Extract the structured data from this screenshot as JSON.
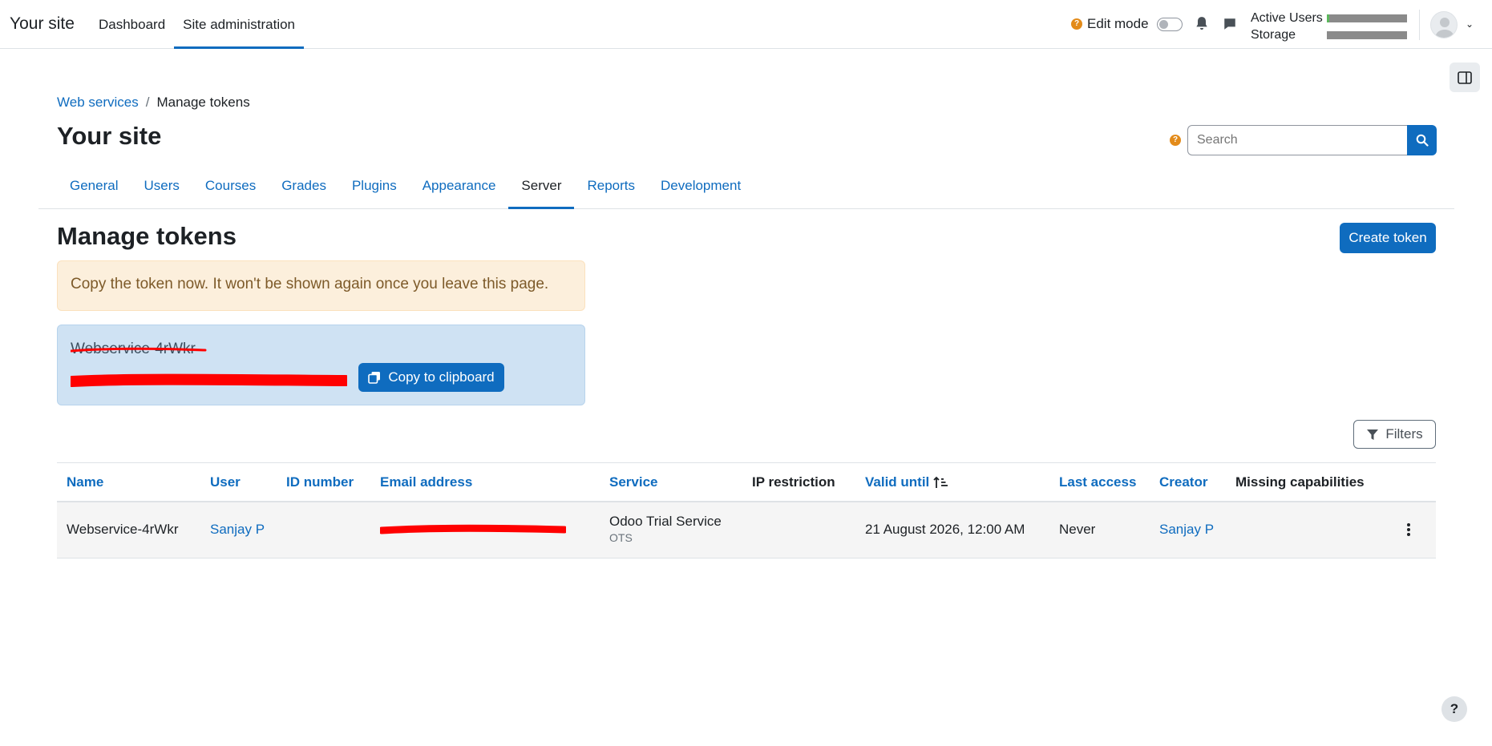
{
  "navbar": {
    "brand": "Your site",
    "primary_nav": [
      "Dashboard",
      "Site administration"
    ],
    "edit_mode_label": "Edit mode",
    "meters": {
      "active_users_label": "Active Users",
      "active_users_fraction": 0.03,
      "storage_label": "Storage",
      "storage_fraction": 0.0
    }
  },
  "breadcrumb": {
    "parent": "Web services",
    "separator": "/",
    "current": "Manage tokens"
  },
  "page": {
    "site_title": "Your site",
    "heading": "Manage tokens"
  },
  "search": {
    "placeholder": "Search"
  },
  "secondary_nav": {
    "tabs": [
      "General",
      "Users",
      "Courses",
      "Grades",
      "Plugins",
      "Appearance",
      "Server",
      "Reports",
      "Development"
    ],
    "active": "Server"
  },
  "actions": {
    "create_token": "Create token",
    "copy_to_clipboard": "Copy to clipboard",
    "filters": "Filters"
  },
  "alerts": {
    "warning": "Copy the token now. It won't be shown again once you leave this page.",
    "token_name": "Webservice-4rWkr"
  },
  "table": {
    "headers": {
      "name": "Name",
      "user": "User",
      "id_number": "ID number",
      "email": "Email address",
      "service": "Service",
      "ip_restriction": "IP restriction",
      "valid_until": "Valid until",
      "last_access": "Last access",
      "creator": "Creator",
      "missing_capabilities": "Missing capabilities"
    },
    "row": {
      "name": "Webservice-4rWkr",
      "user": "Sanjay P",
      "email": "",
      "service": "Odoo Trial Service",
      "service_short": "OTS",
      "valid_until": "21 August 2026, 12:00 AM",
      "last_access": "Never",
      "creator": "Sanjay P"
    }
  },
  "help_button": "?",
  "colors": {
    "accent": "#0f6cbf",
    "warning_bg": "#fcefdc",
    "info_bg": "#cfe2f3",
    "redaction": "#ff0000"
  }
}
